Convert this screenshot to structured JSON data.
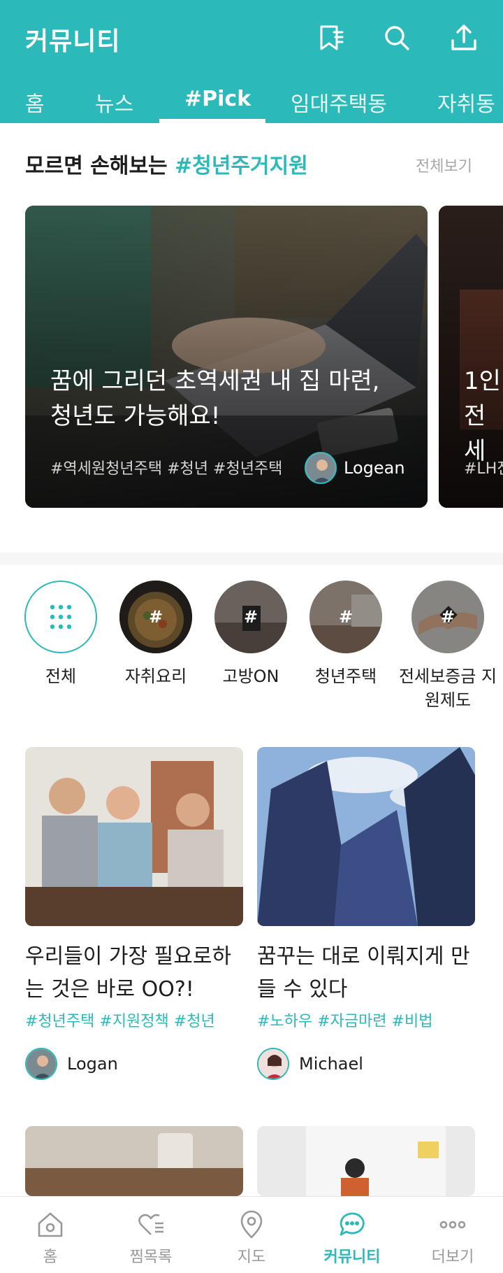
{
  "header": {
    "title": "커뮤니티",
    "icons": [
      "bookmark-list-icon",
      "search-icon",
      "share-icon"
    ],
    "tabs": [
      {
        "label": "홈"
      },
      {
        "label": "뉴스"
      },
      {
        "label": "#Pick",
        "active": true
      },
      {
        "label": "임대주택동"
      },
      {
        "label": "자취동"
      }
    ]
  },
  "section": {
    "title": "모르면 손해보는 ",
    "title_highlight": "#청년주거지원",
    "see_all": "전체보기"
  },
  "featured": [
    {
      "headline": "꿈에 그리던 초역세권 내 집 마련, 청년도 가능해요!",
      "tags": "#역세원청년주택 #청년 #청년주택",
      "author": "Logean"
    },
    {
      "headline": "1인 전세",
      "tags": "#LH전"
    }
  ],
  "categories": [
    {
      "label": "전체"
    },
    {
      "label": "자취요리",
      "hash": "#"
    },
    {
      "label": "고방ON",
      "hash": "#"
    },
    {
      "label": "청년주택",
      "hash": "#"
    },
    {
      "label": "전세보증금 지원제도",
      "hash": "#"
    }
  ],
  "posts": [
    {
      "title": "우리들이 가장 필요로하는 것은 바로 OO?!",
      "tags": "#청년주택 #지원정책 #청년",
      "author": "Logan"
    },
    {
      "title": "꿈꾸는 대로 이뤄지게 만들 수 있다",
      "tags": "#노하우 #자금마련 #비법",
      "author": "Michael"
    }
  ],
  "bottom_nav": [
    {
      "label": "홈",
      "icon": "home-icon"
    },
    {
      "label": "찜목록",
      "icon": "heart-list-icon"
    },
    {
      "label": "지도",
      "icon": "map-pin-icon"
    },
    {
      "label": "커뮤니티",
      "icon": "chat-bubble-icon",
      "active": true
    },
    {
      "label": "더보기",
      "icon": "more-icon"
    }
  ],
  "colors": {
    "brand": "#2bb9b9",
    "muted": "#a7a7a7"
  }
}
